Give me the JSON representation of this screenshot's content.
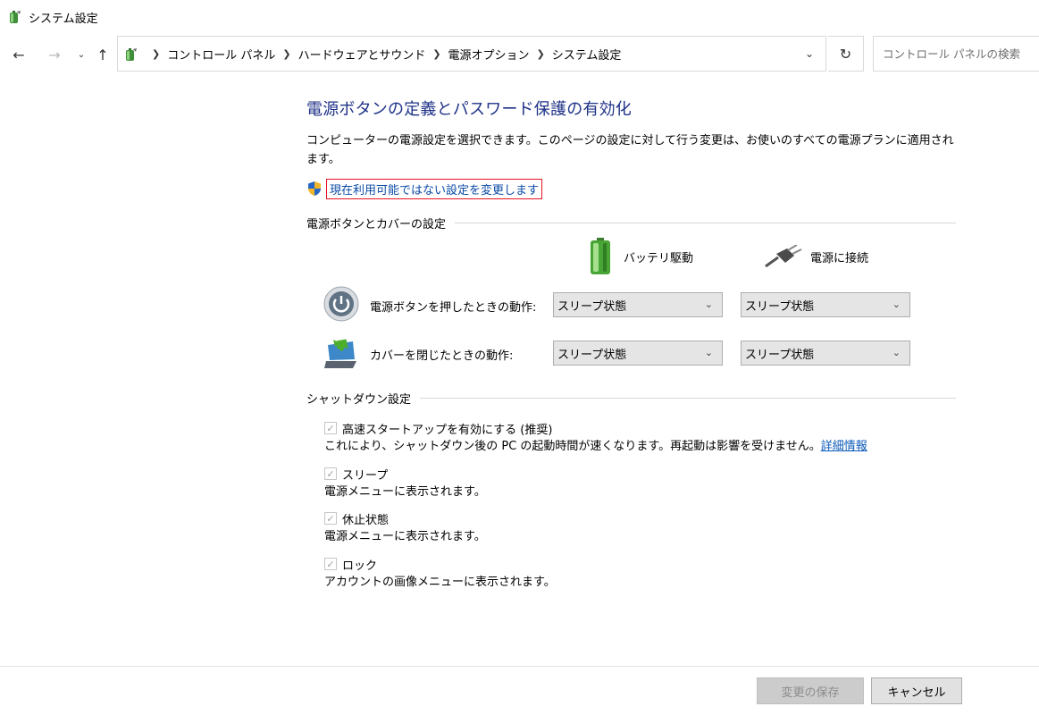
{
  "window": {
    "title": "システム設定",
    "app_icon": "power-options-icon"
  },
  "nav": {
    "back_icon": "back-arrow-icon",
    "forward_icon": "forward-arrow-icon",
    "recent_icon": "chevron-down-icon",
    "up_icon": "up-arrow-icon"
  },
  "breadcrumb": [
    "コントロール パネル",
    "ハードウェアとサウンド",
    "電源オプション",
    "システム設定"
  ],
  "search": {
    "placeholder": "コントロール パネルの検索"
  },
  "main": {
    "title": "電源ボタンの定義とパスワード保護の有効化",
    "description": "コンピューターの電源設定を選択できます。このページの設定に対して行う変更は、お使いのすべての電源プランに適用されます。",
    "change_link": "現在利用可能ではない設定を変更します"
  },
  "power_section": {
    "header": "電源ボタンとカバーの設定",
    "columns": {
      "battery": "バッテリ駆動",
      "plugged": "電源に接続"
    },
    "rows": [
      {
        "label": "電源ボタンを押したときの動作:",
        "battery_value": "スリープ状態",
        "plugged_value": "スリープ状態",
        "icon": "power-button-icon"
      },
      {
        "label": "カバーを閉じたときの動作:",
        "battery_value": "スリープ状態",
        "plugged_value": "スリープ状態",
        "icon": "laptop-lid-icon"
      }
    ]
  },
  "shutdown_section": {
    "header": "シャットダウン設定",
    "options": [
      {
        "label": "高速スタートアップを有効にする (推奨)",
        "checked": true,
        "description": "これにより、シャットダウン後の PC の起動時間が速くなります。再起動は影響を受けません。",
        "link": "詳細情報"
      },
      {
        "label": "スリープ",
        "checked": true,
        "description": "電源メニューに表示されます。"
      },
      {
        "label": "休止状態",
        "checked": true,
        "description": "電源メニューに表示されます。"
      },
      {
        "label": "ロック",
        "checked": true,
        "description": "アカウントの画像メニューに表示されます。"
      }
    ]
  },
  "footer": {
    "save_label": "変更の保存",
    "cancel_label": "キャンセル"
  }
}
